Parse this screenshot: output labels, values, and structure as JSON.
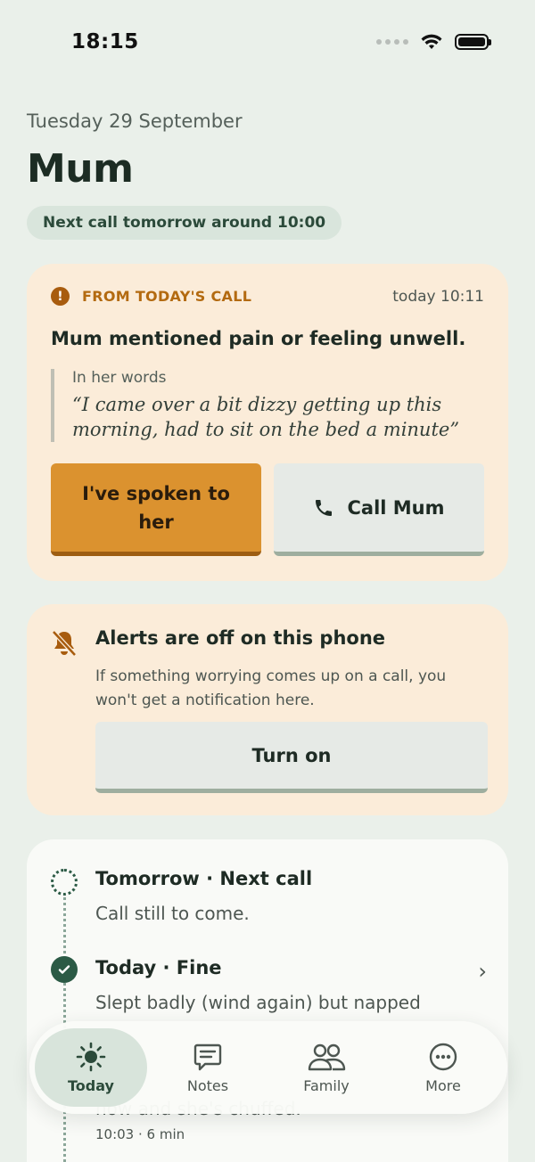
{
  "status_bar": {
    "time": "18:15"
  },
  "header": {
    "date": "Tuesday 29 September",
    "title": "Mum",
    "next_call": "Next call tomorrow around 10:00"
  },
  "alert": {
    "label": "FROM TODAY'S CALL",
    "time": "today 10:11",
    "headline": "Mum mentioned pain or feeling unwell.",
    "quote_label": "In her words",
    "quote": "“I came over a bit dizzy getting up this morning, had to sit on the bed a minute”",
    "primary_button": "I've spoken to her",
    "secondary_button": "Call Mum",
    "accent": "#db922f"
  },
  "notifications": {
    "title": "Alerts are off on this phone",
    "body": "If something worrying comes up on a call, you won't get a notification here.",
    "button": "Turn on"
  },
  "timeline": [
    {
      "title": "Tomorrow · Next call",
      "subtitle": "Call still to come.",
      "status": "pending"
    },
    {
      "title": "Today · Fine",
      "subtitle": "Slept badly (wind again) but napped",
      "subtitle_continued": "now and she's chuffed.",
      "meta": "10:03 · 6 min",
      "status": "done"
    }
  ],
  "tabs": [
    {
      "label": "Today",
      "icon": "sun-icon",
      "active": true
    },
    {
      "label": "Notes",
      "icon": "notes-icon",
      "active": false
    },
    {
      "label": "Family",
      "icon": "family-icon",
      "active": false
    },
    {
      "label": "More",
      "icon": "more-icon",
      "active": false
    }
  ]
}
